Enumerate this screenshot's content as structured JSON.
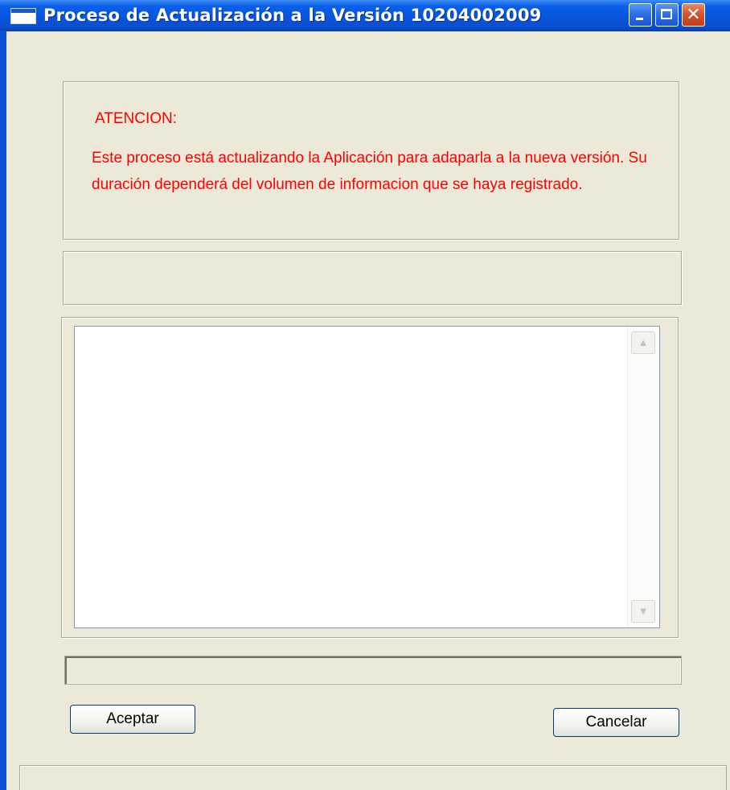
{
  "window": {
    "title": "Proceso de Actualización a la Versión 10204002009",
    "controls": {
      "minimize_icon": "minimize-icon",
      "maximize_icon": "maximize-icon",
      "close_icon": "close-icon",
      "close_glyph": "✕"
    }
  },
  "warning": {
    "title": "ATENCION:",
    "message": "Este proceso está actualizando la Aplicación para adaparla a la nueva versión. Su duración dependerá del volumen de informacion que se haya registrado.",
    "color": "#ff0000"
  },
  "status": {
    "text": ""
  },
  "log": {
    "text": "",
    "scroll_up_glyph": "▲",
    "scroll_down_glyph": "▼"
  },
  "progress": {
    "value": 0
  },
  "buttons": {
    "accept": "Aceptar",
    "cancel": "Cancelar"
  },
  "colors": {
    "titlebar": "#0654dc",
    "face": "#ece9d8"
  }
}
